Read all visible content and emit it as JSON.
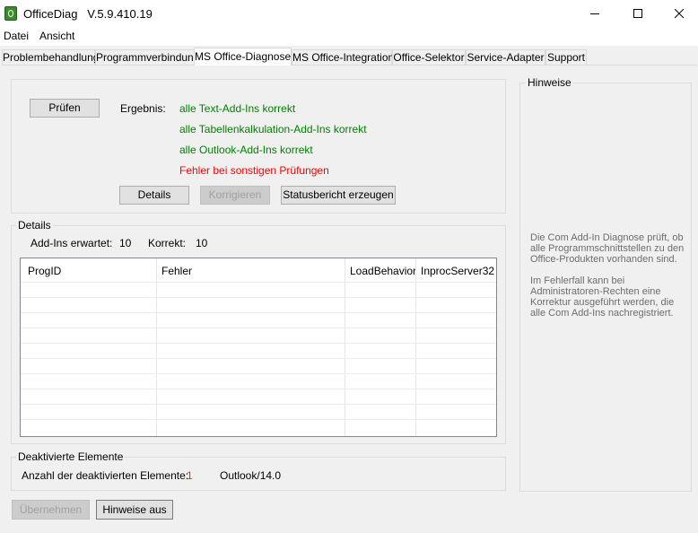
{
  "window": {
    "title": "OfficeDiag   V.5.9.410.19"
  },
  "menu": {
    "items": [
      "Datei",
      "Ansicht"
    ]
  },
  "tabs": [
    {
      "label": "Problembehandlung"
    },
    {
      "label": "Programmverbindung"
    },
    {
      "label": "MS Office-Diagnose"
    },
    {
      "label": "MS Office-Integration"
    },
    {
      "label": "Office-Selektor"
    },
    {
      "label": "Service-Adapter"
    },
    {
      "label": "Support"
    }
  ],
  "active_tab": "MS Office-Diagnose",
  "check": {
    "button_label": "Prüfen",
    "result_label": "Ergebnis:",
    "results": [
      "alle Text-Add-Ins korrekt",
      "alle Tabellenkalkulation-Add-Ins korrekt",
      "alle Outlook-Add-Ins korrekt",
      "Fehler bei sonstigen Prüfungen"
    ],
    "details_button": "Details",
    "fix_button": "Korrigieren",
    "report_button": "Statusbericht erzeugen"
  },
  "details": {
    "legend": "Details",
    "expected_label": "Add-Ins erwartet:",
    "expected_value": "10",
    "correct_label": "Korrekt:",
    "correct_value": "10",
    "columns": [
      "ProgID",
      "Fehler",
      "LoadBehavior",
      "InprocServer32"
    ]
  },
  "deactivated": {
    "legend": "Deaktivierte Elemente",
    "count_label": "Anzahl der deaktivierten Elemente:",
    "count_value": "1",
    "item": "Outlook/14.0"
  },
  "hints": {
    "legend": "Hinweise",
    "paragraph1": "Die Com Add-In Diagnose prüft, ob alle Programmschnittstellen zu den Office-Produkten vorhanden sind.",
    "paragraph2": "Im Fehlerfall kann bei Administratoren-Rechten eine Korrektur ausgeführt werden, die alle Com Add-Ins nachregistriert."
  },
  "footer": {
    "apply_button": "Übernehmen",
    "hints_toggle_button": "Hinweise aus"
  },
  "colors": {
    "ok": "#008000",
    "error": "#ff0000",
    "count": "#d04010"
  }
}
